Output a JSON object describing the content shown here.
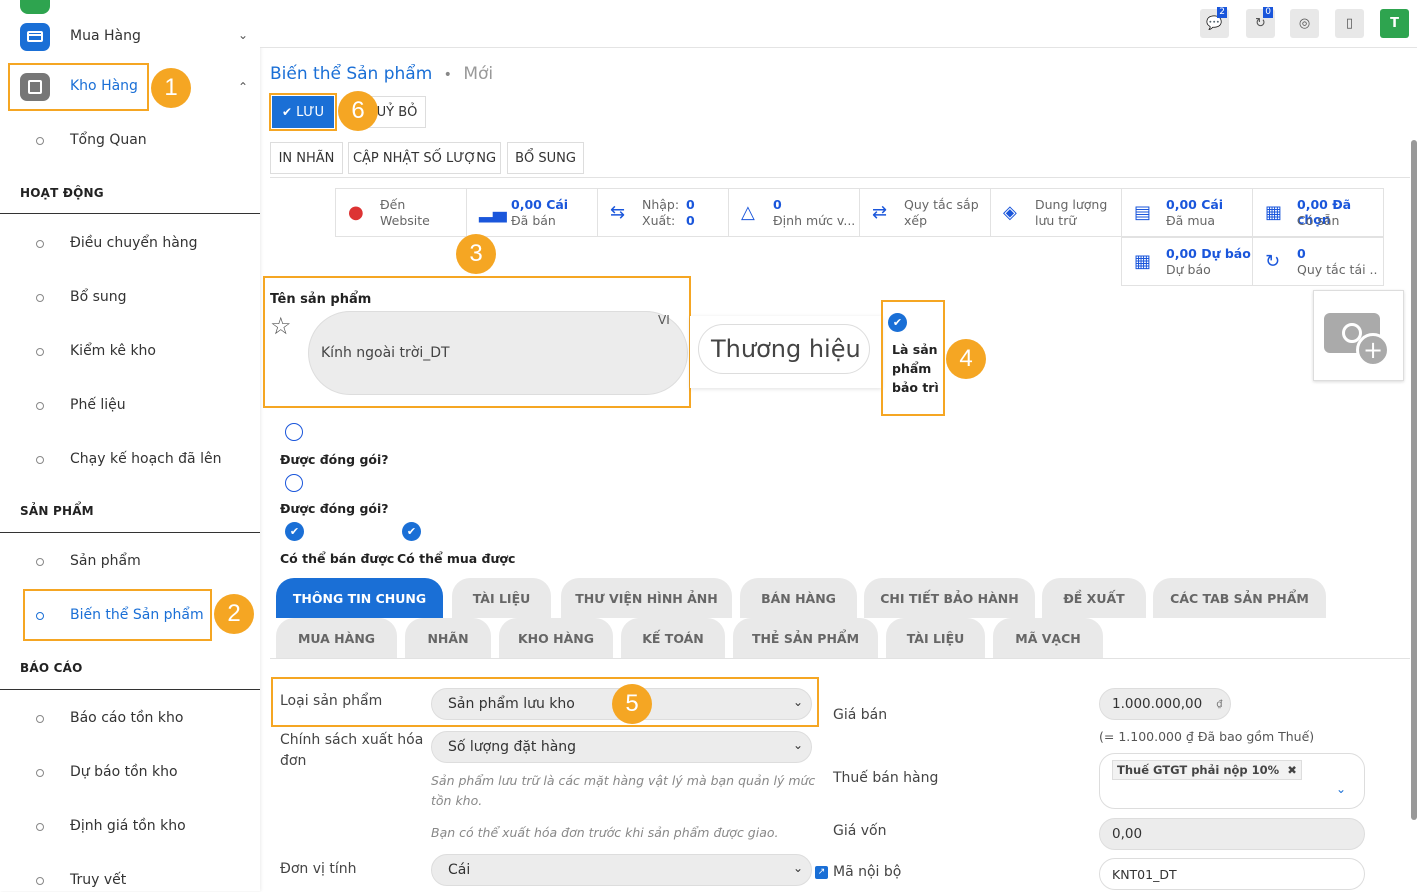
{
  "sidebar": {
    "mua_hang": "Mua Hàng",
    "kho_hang": "Kho Hàng",
    "tong_quan": "Tổng Quan",
    "sec_hoat_dong": "HOẠT ĐỘNG",
    "hoat_dong_items": [
      "Điều chuyển hàng",
      "Bổ sung",
      "Kiểm kê kho",
      "Phế liệu",
      "Chạy kế hoạch đã lên"
    ],
    "sec_san_pham": "SẢN PHẨM",
    "san_pham_items": [
      "Sản phẩm",
      "Biến thể Sản phẩm"
    ],
    "sec_bao_cao": "BÁO CÁO",
    "bao_cao_items": [
      "Báo cáo tồn kho",
      "Dự báo tồn kho",
      "Định giá tồn kho",
      "Truy vết"
    ]
  },
  "topbar": {
    "chat_count": "2",
    "activity_count": "0",
    "avatar_letter": "T"
  },
  "breadcrumb": {
    "parent": "Biến thể Sản phẩm",
    "sep": "•",
    "current": "Mới"
  },
  "actions": {
    "save": "LƯU",
    "discard": "UỶ BỎ"
  },
  "header_buttons": [
    "IN NHÃN",
    "CẬP NHẬT SỐ LƯỢNG",
    "BỔ SUNG"
  ],
  "stats": {
    "website": {
      "l1": "Đến",
      "l2": "Website"
    },
    "sold": {
      "value": "0,00 Cái",
      "label": "Đã bán"
    },
    "inout": {
      "in_label": "Nhập:",
      "in_val": "0",
      "out_label": "Xuất:",
      "out_val": "0"
    },
    "reorder": {
      "value": "0",
      "label": "Định mức v..."
    },
    "putaway": {
      "l1": "Quy tắc sắp",
      "l2": "xếp"
    },
    "capacity": {
      "l1": "Dung lượng",
      "l2": "lưu trữ"
    },
    "purchased": {
      "value": "0,00 Cái",
      "label": "Đã mua"
    },
    "onhand": {
      "value": "0,00 Đã chọn",
      "label": "Có sẵn"
    },
    "forecast": {
      "value": "0,00 Dự báo",
      "label": "Dự báo"
    },
    "replenish": {
      "value": "0",
      "label": "Quy tắc tái ..."
    }
  },
  "form": {
    "name_label": "Tên sản phẩm",
    "name_value": "Kính ngoài trời_DT",
    "lang": "VI",
    "brand_placeholder": "Thương hiệu",
    "maintenance_label": "Là sản phẩm bảo trì",
    "packed_label_1": "Được đóng gói?",
    "packed_label_2": "Được đóng gói?",
    "can_sell": "Có thể bán được",
    "can_buy": "Có thể mua được"
  },
  "tabs_row1": [
    "THÔNG TIN CHUNG",
    "TÀI LIỆU",
    "THƯ VIỆN HÌNH ẢNH",
    "BÁN HÀNG",
    "CHI TIẾT BẢO HÀNH",
    "ĐỀ XUẤT",
    "CÁC TAB SẢN PHẨM"
  ],
  "tabs_row2": [
    "MUA HÀNG",
    "NHÃN",
    "KHO HÀNG",
    "KẾ TOÁN",
    "THẺ SẢN PHẨM",
    "TÀI LIỆU",
    "MÃ VẠCH"
  ],
  "general": {
    "type_label": "Loại sản phẩm",
    "type_value": "Sản phẩm lưu kho",
    "invoice_policy_label": "Chính sách xuất hóa đơn",
    "invoice_policy_value": "Số lượng đặt hàng",
    "help1": "Sản phẩm lưu trữ là các mặt hàng vật lý mà bạn quản lý mức tồn kho.",
    "help2": "Bạn có thể xuất hóa đơn trước khi sản phẩm được giao.",
    "uom_label": "Đơn vị tính",
    "uom_value": "Cái",
    "sale_price_label": "Giá bán",
    "sale_price_value": "1.000.000,00",
    "currency": "₫",
    "tax_included": "(= 1.100.000 ₫ Đã bao gồm Thuế)",
    "sales_tax_label": "Thuế bán hàng",
    "sales_tax_tag": "Thuế GTGT phải nộp 10%",
    "cost_label": "Giá vốn",
    "cost_value": "0,00",
    "internal_ref_label": "Mã nội bộ",
    "internal_ref_value": "KNT01_DT"
  },
  "annotations": [
    "1",
    "2",
    "3",
    "4",
    "5",
    "6"
  ],
  "colors": {
    "accent": "#1a6fd6",
    "highlight": "#f5a623"
  }
}
